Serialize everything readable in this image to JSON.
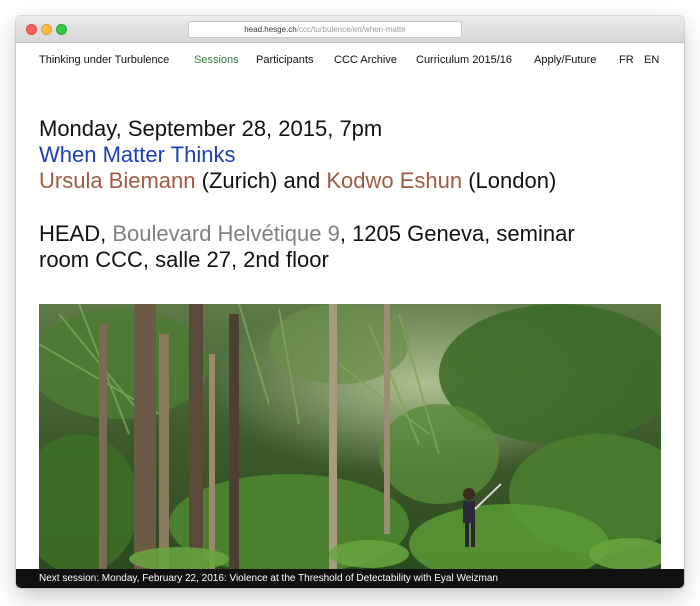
{
  "browser": {
    "url_host": "head.hesge.ch",
    "url_path": "/ccc/turbulence/en/when-matte"
  },
  "nav": {
    "items": [
      {
        "label": "Thinking under Turbulence"
      },
      {
        "label": "Sessions",
        "active": true
      },
      {
        "label": "Participants"
      },
      {
        "label": "CCC Archive"
      },
      {
        "label": "Curriculum 2015/16"
      },
      {
        "label": "Apply/Future"
      },
      {
        "label": "FR"
      },
      {
        "label": "EN"
      }
    ]
  },
  "event": {
    "date": "Monday, September 28, 2015, 7pm",
    "title": "When Matter Thinks",
    "speaker1": "Ursula Biemann",
    "speaker1_city": " (Zurich) and ",
    "speaker2": "Kodwo Eshun",
    "speaker2_city": " (London)",
    "venue_name": "HEAD, ",
    "venue_street": "Boulevard Helvétique 9",
    "venue_rest": ", 1205 Geneva, seminar",
    "venue_line2": "room CCC, salle 27, 2nd floor"
  },
  "footer": {
    "next_session": "Next session: Monday, February 22, 2016: Violence at the Threshold of Detectability with Eyal Weizman"
  },
  "colors": {
    "title_blue": "#1d3fb5",
    "speaker_brown": "#a05a43",
    "street_grey": "#808080",
    "nav_active_green": "#3a7a3a",
    "footer_black": "#111111"
  }
}
